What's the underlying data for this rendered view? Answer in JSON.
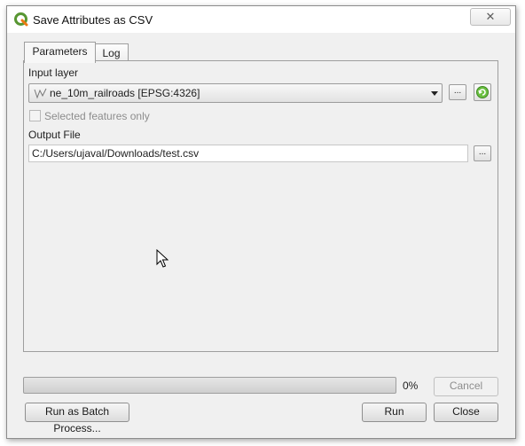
{
  "window": {
    "title": "Save Attributes as CSV",
    "close_label": "✕"
  },
  "tabs": [
    {
      "label": "Parameters",
      "active": true
    },
    {
      "label": "Log",
      "active": false
    }
  ],
  "parameters": {
    "input_layer_label": "Input layer",
    "input_layer_value": "ne_10m_railroads [EPSG:4326]",
    "browse_label": "...",
    "selected_only_label": "Selected features only",
    "selected_only_checked": false,
    "output_file_label": "Output File",
    "output_file_value": "C:/Users/ujaval/Downloads/test.csv",
    "output_browse_label": "..."
  },
  "progress": {
    "value": 0,
    "text": "0%"
  },
  "buttons": {
    "cancel": "Cancel",
    "batch": "Run as Batch Process...",
    "run": "Run",
    "close": "Close"
  },
  "colors": {
    "accent": "#06b025",
    "qgis_green": "#589632"
  }
}
